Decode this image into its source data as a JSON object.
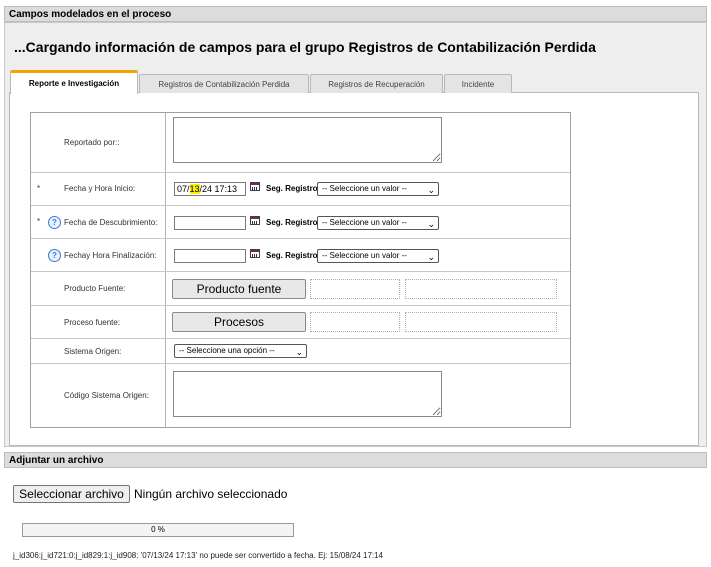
{
  "header": {
    "title": "Campos modelados en el proceso"
  },
  "loading_message": "...Cargando información de campos para el grupo Registros de Contabilización Perdida",
  "tabs": [
    {
      "label": "Reporte e Investigación",
      "active": true
    },
    {
      "label": "Registros de Contabilización Perdida",
      "active": false
    },
    {
      "label": "Registros de Recuperación",
      "active": false
    },
    {
      "label": "Incidente",
      "active": false
    }
  ],
  "form": {
    "reportado": {
      "label": "Reportado por::",
      "value": ""
    },
    "fecha_inicio": {
      "label": "Fecha y Hora Inicio:",
      "required": "*",
      "value_pre": "07/",
      "value_hl": "13",
      "value_post": "/24 17:13",
      "seg_label": "Seg. Registro",
      "select": "-- Seleccione un valor --"
    },
    "fecha_descubrimiento": {
      "label": "Fecha de Descubrimiento:",
      "required": "*",
      "help": "?",
      "value": "",
      "seg_label": "Seg. Registro",
      "select": "-- Seleccione un valor --"
    },
    "fecha_finalizacion": {
      "label": "Fechay Hora Finalización:",
      "help": "?",
      "value": "",
      "seg_label": "Seg. Registro",
      "select": "-- Seleccione un valor --"
    },
    "producto_fuente": {
      "label": "Producto Fuente:",
      "button": "Producto fuente"
    },
    "proceso_fuente": {
      "label": "Proceso fuente:",
      "button": "Procesos"
    },
    "sistema_origen": {
      "label": "Sistema Origen:",
      "select": "-- Seleccione una opción --"
    },
    "codigo_sistema": {
      "label": "Código Sistema Origen:",
      "value": ""
    }
  },
  "attach": {
    "title": "Adjuntar un archivo",
    "button": "Seleccionar archivo",
    "no_file": "Ningún archivo seleccionado",
    "progress_percent": 0,
    "progress_text": "0 %"
  },
  "error_message": "j_id306:j_id721:0:j_id829:1:j_id908: '07/13/24 17:13' no puede ser convertido a fecha. Ej: 15/08/24 17:14",
  "icons": {
    "help": "help-circle-icon",
    "calendar": "calendar-icon",
    "select_arrow": "chevron-down-icon"
  },
  "colors": {
    "active_tab_accent": "#f5a300",
    "help_icon": "#3a7bd5",
    "highlight": "#ffef00"
  }
}
